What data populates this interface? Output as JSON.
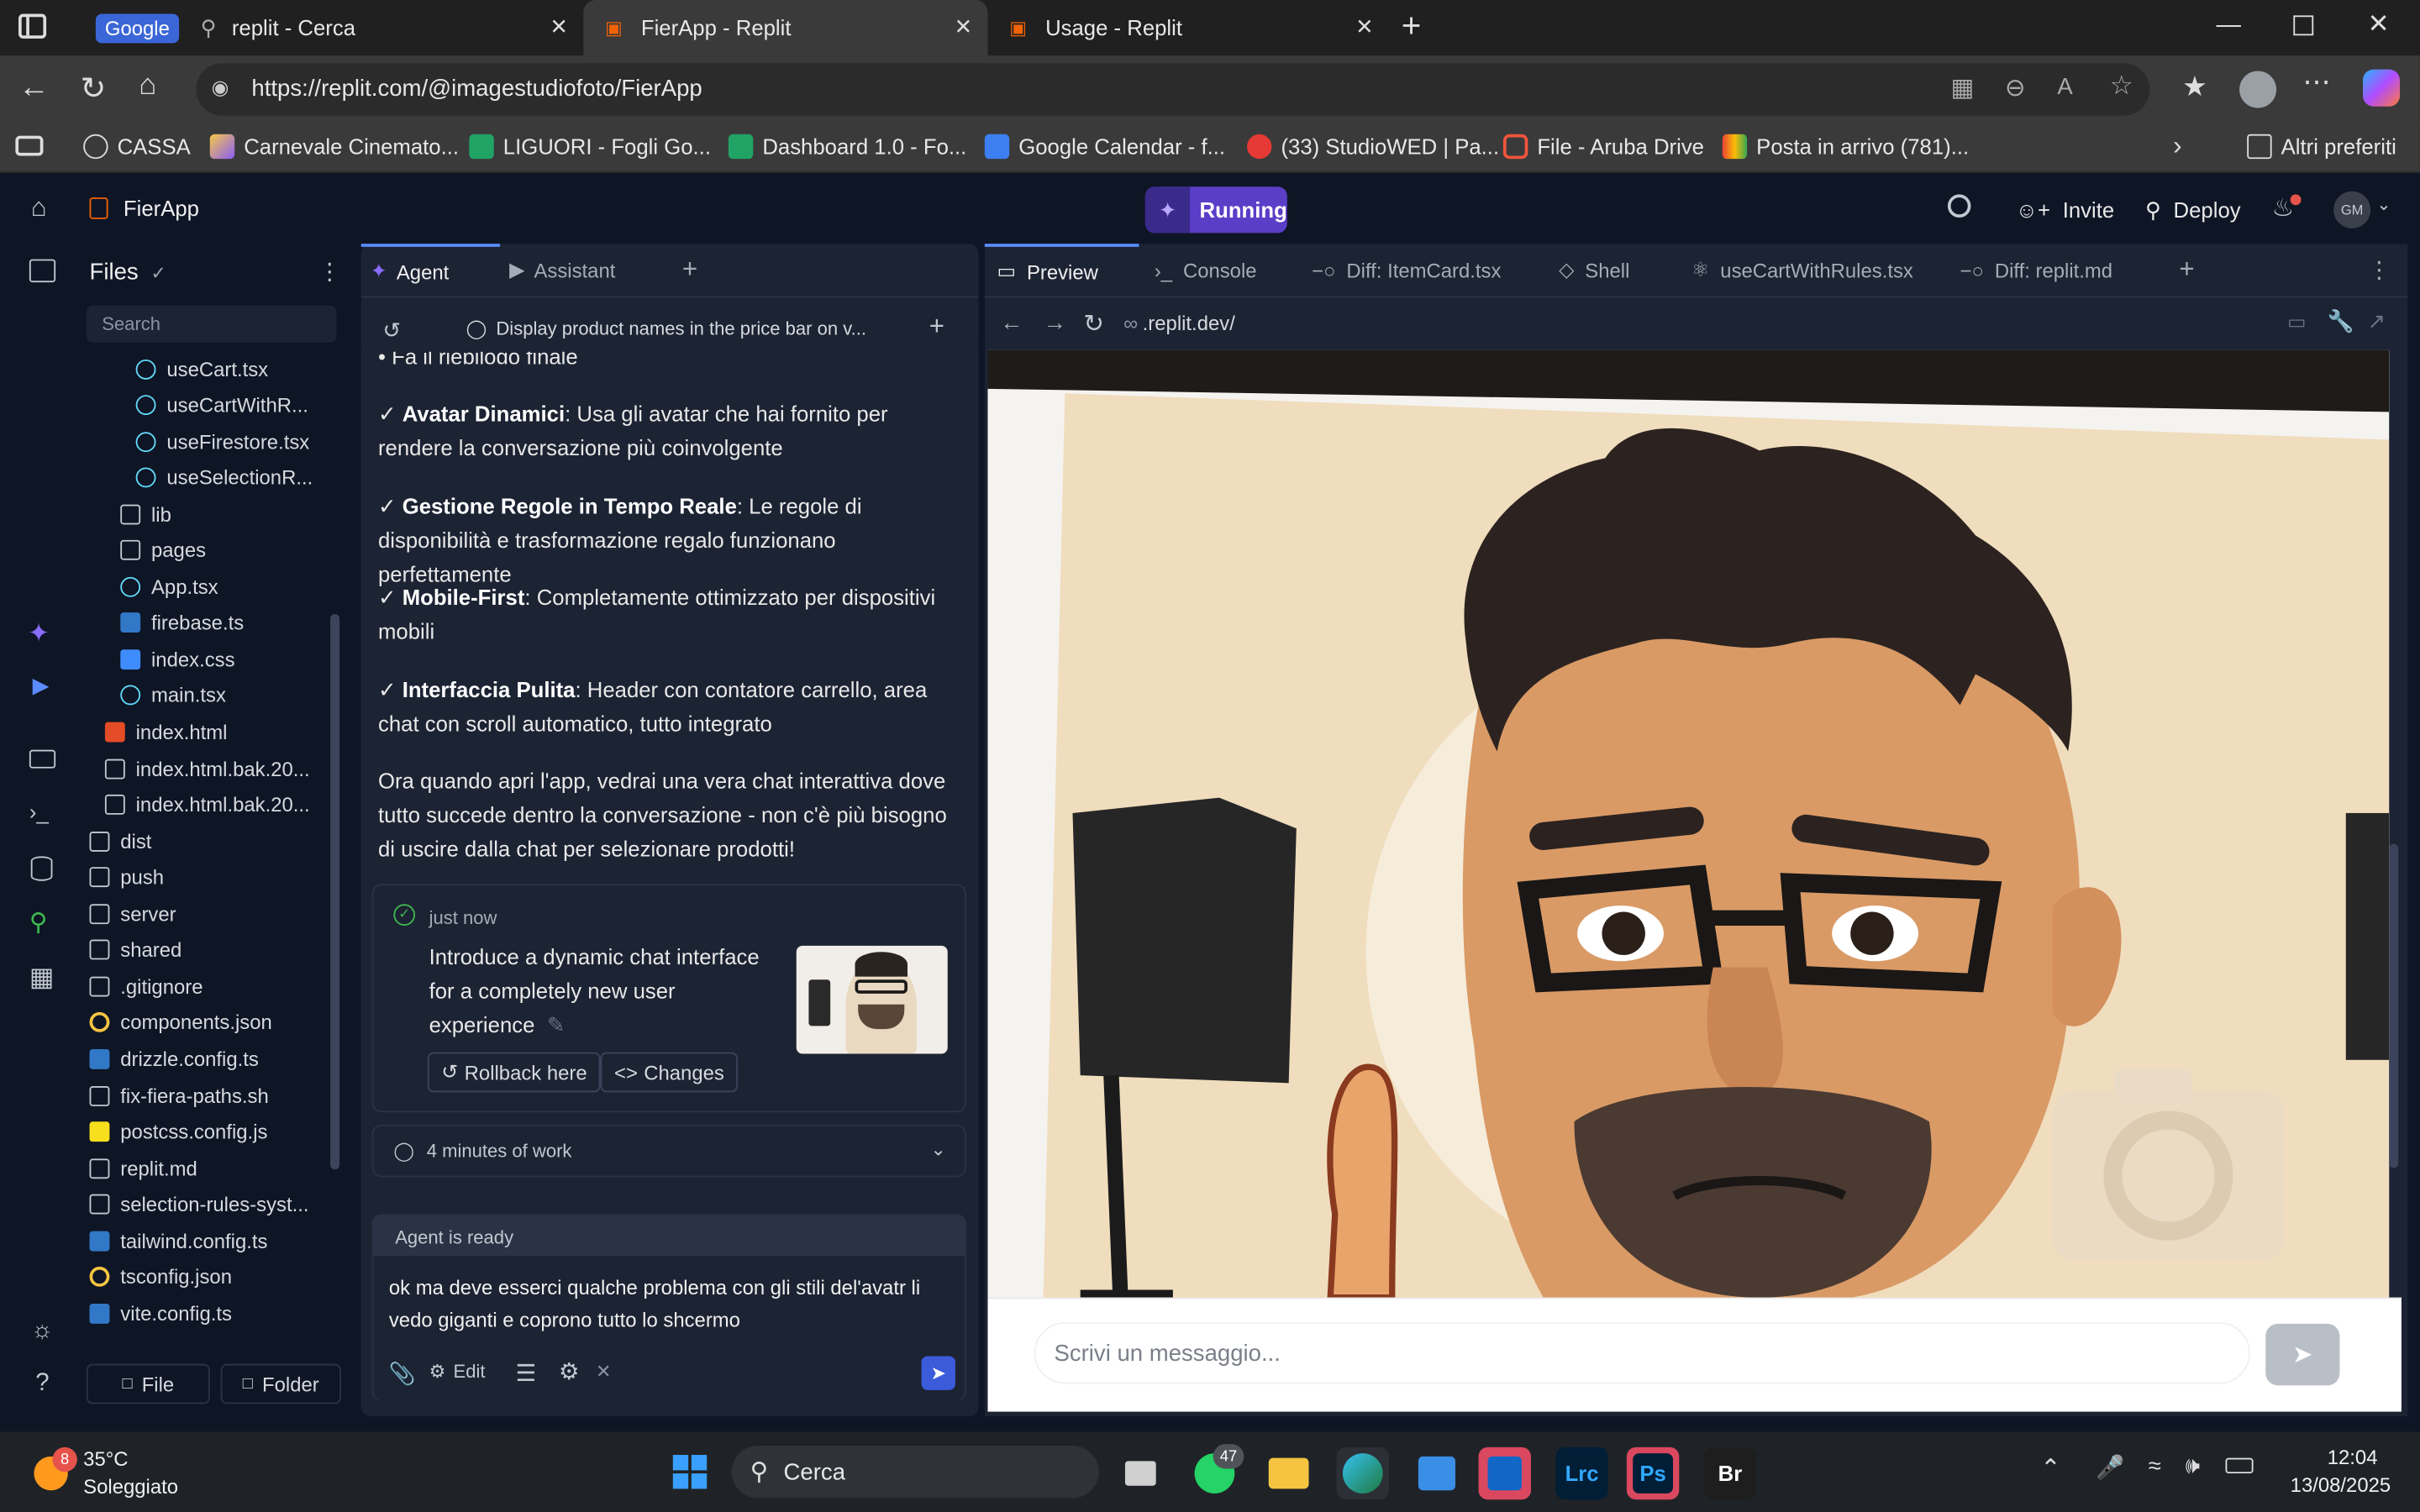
{
  "browser": {
    "tabs": [
      {
        "label": "Google",
        "title": "replit - Cerca"
      },
      {
        "title": "FierApp - Replit"
      },
      {
        "title": "Usage - Replit"
      }
    ],
    "url": "https://replit.com/@imagestudiofoto/FierApp",
    "bookmarks": [
      "CASSA",
      "Carnevale Cinemato...",
      "LIGUORI - Fogli Go...",
      "Dashboard 1.0 - Fo...",
      "Google Calendar - f...",
      "(33) StudioWED | Pa...",
      "File - Aruba Drive",
      "Posta in arrivo (781)..."
    ],
    "bookmarks_other": "Altri preferiti"
  },
  "replit": {
    "app_name": "FierApp",
    "status": "Running",
    "invite": "Invite",
    "deploy": "Deploy",
    "avatar": "GM"
  },
  "files": {
    "title": "Files",
    "search_placeholder": "Search",
    "items": [
      {
        "name": "useCart.tsx",
        "icon": "react"
      },
      {
        "name": "useCartWithR...",
        "icon": "react"
      },
      {
        "name": "useFirestore.tsx",
        "icon": "react"
      },
      {
        "name": "useSelectionR...",
        "icon": "react"
      },
      {
        "name": "lib",
        "icon": "folder"
      },
      {
        "name": "pages",
        "icon": "folder"
      },
      {
        "name": "App.tsx",
        "icon": "react"
      },
      {
        "name": "firebase.ts",
        "icon": "ts"
      },
      {
        "name": "index.css",
        "icon": "css"
      },
      {
        "name": "main.tsx",
        "icon": "react"
      },
      {
        "name": "index.html",
        "icon": "html"
      },
      {
        "name": "index.html.bak.20...",
        "icon": "file"
      },
      {
        "name": "index.html.bak.20...",
        "icon": "file"
      },
      {
        "name": "dist",
        "icon": "folder"
      },
      {
        "name": "push",
        "icon": "folder"
      },
      {
        "name": "server",
        "icon": "folder"
      },
      {
        "name": "shared",
        "icon": "folder"
      },
      {
        "name": ".gitignore",
        "icon": "file"
      },
      {
        "name": "components.json",
        "icon": "json"
      },
      {
        "name": "drizzle.config.ts",
        "icon": "ts"
      },
      {
        "name": "fix-fiera-paths.sh",
        "icon": "sh"
      },
      {
        "name": "postcss.config.js",
        "icon": "js"
      },
      {
        "name": "replit.md",
        "icon": "md"
      },
      {
        "name": "selection-rules-syst...",
        "icon": "md"
      },
      {
        "name": "tailwind.config.ts",
        "icon": "ts"
      },
      {
        "name": "tsconfig.json",
        "icon": "json"
      },
      {
        "name": "vite.config.ts",
        "icon": "ts"
      }
    ],
    "new_file": "File",
    "new_folder": "Folder"
  },
  "agent": {
    "tab_agent": "Agent",
    "tab_assistant": "Assistant",
    "thread_title": "Display product names in the price bar on v...",
    "cut_line": "Fa il riepilogo finale",
    "bullets": [
      {
        "title": "Avatar Dinamici",
        "text": ": Usa gli avatar che hai fornito per rendere la conversazione più coinvolgente"
      },
      {
        "title": "Gestione Regole in Tempo Reale",
        "text": ": Le regole di disponibilità e trasformazione regalo funzionano perfettamente"
      },
      {
        "title": "Mobile-First",
        "text": ": Completamente ottimizzato per dispositivi mobili"
      },
      {
        "title": "Interfaccia Pulita",
        "text": ": Header con contatore carrello, area chat con scroll automatico, tutto integrato"
      }
    ],
    "summary": "Ora quando apri l'app, vedrai una vera chat interattiva dove tutto succede dentro la conversazione - non c'è più bisogno di uscire dalla chat per selezionare prodotti!",
    "checkpoint": {
      "time": "just now",
      "text": "Introduce a dynamic chat interface for a completely new user experience",
      "rollback": "Rollback here",
      "changes": "Changes"
    },
    "work_time": "4 minutes of work",
    "status": "Agent is ready",
    "input_text": "ok ma deve esserci qualche problema con gli stili del'avatr li vedo giganti e coprono tutto lo shcermo",
    "edit_label": "Edit"
  },
  "preview": {
    "tabs": [
      "Preview",
      "Console",
      "Diff: ItemCard.tsx",
      "Shell",
      "useCartWithRules.tsx",
      "Diff: replit.md"
    ],
    "url": ".replit.dev/",
    "chat_placeholder": "Scrivi un messaggio..."
  },
  "taskbar": {
    "weather_badge": "8",
    "temperature": "35°C",
    "weather": "Soleggiato",
    "search": "Cerca",
    "whatsapp_badge": "47",
    "time": "12:04",
    "date": "13/08/2025",
    "apps": [
      "Lrc",
      "Ps",
      "Br"
    ]
  },
  "colors": {
    "accent": "#5b3ec8",
    "panel": "#1c2333",
    "background": "#0e1525",
    "send": "#3b5bdb"
  }
}
